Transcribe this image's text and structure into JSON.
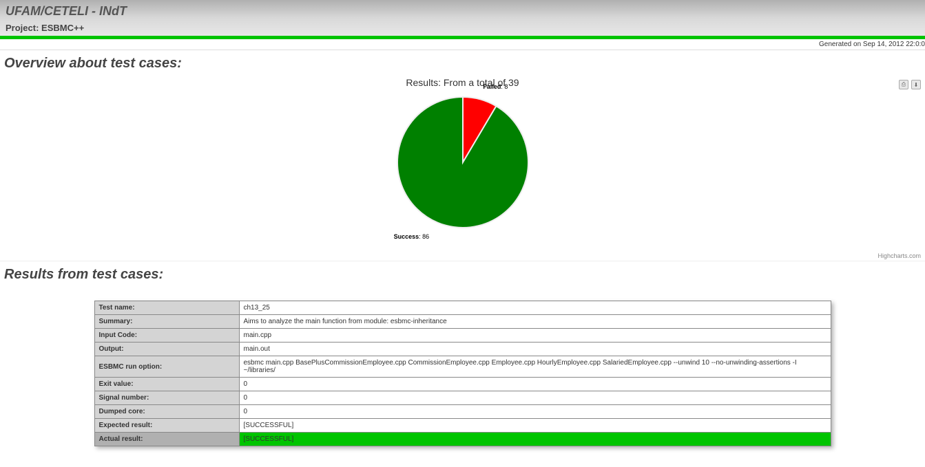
{
  "header": {
    "title": "UFAM/CETELI - INdT",
    "project_label": "Project:",
    "project_name": "ESBMC++"
  },
  "generated": "Generated on Sep 14, 2012 22:0:0",
  "sections": {
    "overview": "Overview about test cases:",
    "results": "Results from test cases:"
  },
  "chart_data": {
    "type": "pie",
    "title": "Results: From a total of 39",
    "series": [
      {
        "name": "Failed",
        "value": 8,
        "color": "#ff0000"
      },
      {
        "name": "Success",
        "value": 86,
        "color": "#008000"
      }
    ],
    "credits": "Highcharts.com",
    "icons": {
      "print": "print-icon",
      "export": "export-icon"
    }
  },
  "result_rows": [
    {
      "k": "Test name:",
      "v": "ch13_25"
    },
    {
      "k": "Summary:",
      "v": "Aims to analyze the main function from module: esbmc-inheritance"
    },
    {
      "k": "Input Code:",
      "v": "main.cpp"
    },
    {
      "k": "Output:",
      "v": "main.out"
    },
    {
      "k": "ESBMC run option:",
      "v": "esbmc main.cpp BasePlusCommissionEmployee.cpp CommissionEmployee.cpp Employee.cpp HourlyEmployee.cpp SalariedEmployee.cpp --unwind 10 --no-unwinding-assertions -I ~/libraries/"
    },
    {
      "k": "Exit value:",
      "v": "0"
    },
    {
      "k": "Signal number:",
      "v": "0"
    },
    {
      "k": "Dumped core:",
      "v": "0"
    },
    {
      "k": "Expected result:",
      "v": "[SUCCESSFUL]"
    },
    {
      "k": "Actual result:",
      "v": "[SUCCESSFUL]",
      "highlight": true
    }
  ]
}
